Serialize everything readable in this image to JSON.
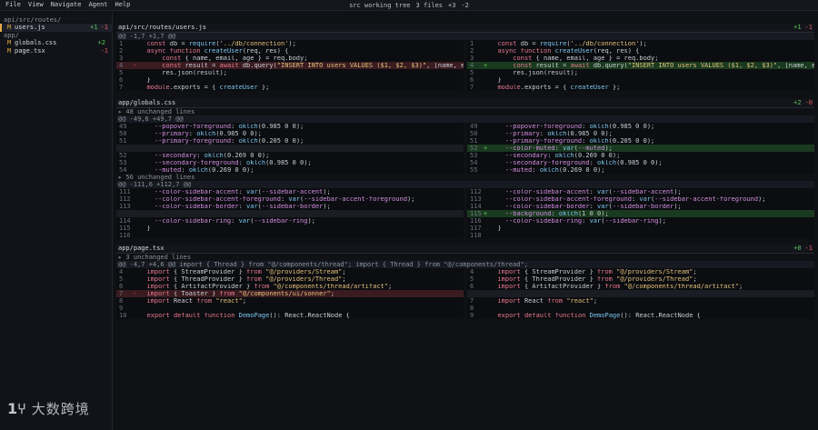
{
  "menubar": {
    "items": [
      "File",
      "View",
      "Navigate",
      "Agent",
      "Help"
    ],
    "status_label": "src working tree",
    "file_count": "3 files",
    "additions": "+3",
    "deletions": "-2"
  },
  "sidebar": {
    "folders": [
      "api/src/routes/",
      "app/"
    ],
    "files": [
      {
        "folder": 0,
        "status": "M",
        "name": "users.js",
        "plus": "+1",
        "minus": "-1",
        "active": true
      },
      {
        "folder": 1,
        "status": "M",
        "name": "globals.css",
        "plus": "+2",
        "minus": "",
        "active": false
      },
      {
        "folder": 1,
        "status": "M",
        "name": "page.tsx",
        "plus": "",
        "minus": "-1",
        "active": false
      }
    ]
  },
  "files": [
    {
      "path": "api/src/routes/users.js",
      "plus": "+1",
      "minus": "-1",
      "sections": [
        {
          "type": "hunk",
          "text": "@@ -1,7 +1,7 @@"
        },
        {
          "type": "rows",
          "rows": [
            {
              "l": {
                "n": "1",
                "k": "",
                "t": "  const db = require('../db/connection');"
              },
              "r": {
                "n": "1",
                "k": "",
                "t": "  const db = require('../db/connection');"
              }
            },
            {
              "l": {
                "n": "2",
                "k": "",
                "t": "  async function createUser(req, res) {"
              },
              "r": {
                "n": "2",
                "k": "",
                "t": "  async function createUser(req, res) {"
              }
            },
            {
              "l": {
                "n": "3",
                "k": "",
                "t": "      const { name, email, age } = req.body;"
              },
              "r": {
                "n": "3",
                "k": "",
                "t": "      const { name, email, age } = req.body;"
              }
            },
            {
              "l": {
                "n": "4",
                "k": "del",
                "t": "      const result = await db.query(\"INSERT INTO users VALUES ($1, $2, $3)\", [name, email, age, address"
              },
              "r": {
                "n": "4",
                "k": "add",
                "t": "      const result = await db.query(\"INSERT INTO users VALUES ($1, $2, $3)\", [name, email, age]);"
              }
            },
            {
              "l": {
                "n": "5",
                "k": "",
                "t": "      res.json(result);"
              },
              "r": {
                "n": "5",
                "k": "",
                "t": "      res.json(result);"
              }
            },
            {
              "l": {
                "n": "6",
                "k": "",
                "t": "  }"
              },
              "r": {
                "n": "6",
                "k": "",
                "t": "  }"
              }
            },
            {
              "l": {
                "n": "7",
                "k": "",
                "t": "  module.exports = { createUser };"
              },
              "r": {
                "n": "7",
                "k": "",
                "t": "  module.exports = { createUser };"
              }
            }
          ]
        }
      ]
    },
    {
      "path": "app/globals.css",
      "plus": "+2",
      "minus": "-0",
      "sections": [
        {
          "type": "collapsed",
          "text": "▸ 48 unchanged lines"
        },
        {
          "type": "hunk",
          "text": "@@ -49,6 +49,7 @@"
        },
        {
          "type": "rows",
          "rows": [
            {
              "l": {
                "n": "49",
                "k": "",
                "t": "    --popover-foreground: oklch(0.985 0 0);"
              },
              "r": {
                "n": "49",
                "k": "",
                "t": "    --popover-foreground: oklch(0.985 0 0);"
              }
            },
            {
              "l": {
                "n": "50",
                "k": "",
                "t": "    --primary: oklch(0.985 0 0);"
              },
              "r": {
                "n": "50",
                "k": "",
                "t": "    --primary: oklch(0.985 0 0);"
              }
            },
            {
              "l": {
                "n": "51",
                "k": "",
                "t": "    --primary-foreground: oklch(0.205 0 0);"
              },
              "r": {
                "n": "51",
                "k": "",
                "t": "    --primary-foreground: oklch(0.205 0 0);"
              }
            },
            {
              "l": {
                "n": "",
                "k": "empty",
                "t": ""
              },
              "r": {
                "n": "52",
                "k": "add",
                "t": "    --color-muted: var(--muted);"
              }
            },
            {
              "l": {
                "n": "52",
                "k": "",
                "t": "    --secondary: oklch(0.269 0 0);"
              },
              "r": {
                "n": "53",
                "k": "",
                "t": "    --secondary: oklch(0.269 0 0);"
              }
            },
            {
              "l": {
                "n": "53",
                "k": "",
                "t": "    --secondary-foreground: oklch(0.985 0 0);"
              },
              "r": {
                "n": "54",
                "k": "",
                "t": "    --secondary-foreground: oklch(0.985 0 0);"
              }
            },
            {
              "l": {
                "n": "54",
                "k": "",
                "t": "    --muted: oklch(0.269 0 0);"
              },
              "r": {
                "n": "55",
                "k": "",
                "t": "    --muted: oklch(0.269 0 0);"
              }
            }
          ]
        },
        {
          "type": "collapsed",
          "text": "▸ 56 unchanged lines"
        },
        {
          "type": "hunk",
          "text": "@@ -111,6 +112,7 @@"
        },
        {
          "type": "rows",
          "rows": [
            {
              "l": {
                "n": "111",
                "k": "",
                "t": "    --color-sidebar-accent: var(--sidebar-accent);"
              },
              "r": {
                "n": "112",
                "k": "",
                "t": "    --color-sidebar-accent: var(--sidebar-accent);"
              }
            },
            {
              "l": {
                "n": "112",
                "k": "",
                "t": "    --color-sidebar-accent-foreground: var(--sidebar-accent-foreground);"
              },
              "r": {
                "n": "113",
                "k": "",
                "t": "    --color-sidebar-accent-foreground: var(--sidebar-accent-foreground);"
              }
            },
            {
              "l": {
                "n": "113",
                "k": "",
                "t": "    --color-sidebar-border: var(--sidebar-border);"
              },
              "r": {
                "n": "114",
                "k": "",
                "t": "    --color-sidebar-border: var(--sidebar-border);"
              }
            },
            {
              "l": {
                "n": "",
                "k": "empty",
                "t": ""
              },
              "r": {
                "n": "115",
                "k": "add",
                "t": "    --background: oklch(1 0 0);"
              }
            },
            {
              "l": {
                "n": "114",
                "k": "",
                "t": "    --color-sidebar-ring: var(--sidebar-ring);"
              },
              "r": {
                "n": "116",
                "k": "",
                "t": "    --color-sidebar-ring: var(--sidebar-ring);"
              }
            },
            {
              "l": {
                "n": "115",
                "k": "",
                "t": "  }"
              },
              "r": {
                "n": "117",
                "k": "",
                "t": "  }"
              }
            },
            {
              "l": {
                "n": "116",
                "k": "",
                "t": ""
              },
              "r": {
                "n": "118",
                "k": "",
                "t": ""
              }
            }
          ]
        }
      ]
    },
    {
      "path": "app/page.tsx",
      "plus": "+0",
      "minus": "-1",
      "sections": [
        {
          "type": "collapsed",
          "text": "▸ 3 unchanged lines"
        },
        {
          "type": "hunk",
          "text": "@@ -4,7 +4,6 @@ import { Thread } from \"@/components/thread\"; import { Thread } from \"@/components/thread\";"
        },
        {
          "type": "rows",
          "rows": [
            {
              "l": {
                "n": "4",
                "k": "",
                "t": "  import { StreamProvider } from \"@/providers/Stream\";"
              },
              "r": {
                "n": "4",
                "k": "",
                "t": "  import { StreamProvider } from \"@/providers/Stream\";"
              }
            },
            {
              "l": {
                "n": "5",
                "k": "",
                "t": "  import { ThreadProvider } from \"@/providers/Thread\";"
              },
              "r": {
                "n": "5",
                "k": "",
                "t": "  import { ThreadProvider } from \"@/providers/Thread\";"
              }
            },
            {
              "l": {
                "n": "6",
                "k": "",
                "t": "  import { ArtifactProvider } from \"@/components/thread/artifact\";"
              },
              "r": {
                "n": "6",
                "k": "",
                "t": "  import { ArtifactProvider } from \"@/components/thread/artifact\";"
              }
            },
            {
              "l": {
                "n": "7",
                "k": "del",
                "t": "  import { Toaster } from \"@/components/ui/sonner\";"
              },
              "r": {
                "n": "",
                "k": "empty",
                "t": ""
              }
            },
            {
              "l": {
                "n": "8",
                "k": "",
                "t": "  import React from \"react\";"
              },
              "r": {
                "n": "7",
                "k": "",
                "t": "  import React from \"react\";"
              }
            },
            {
              "l": {
                "n": "9",
                "k": "",
                "t": ""
              },
              "r": {
                "n": "8",
                "k": "",
                "t": ""
              }
            },
            {
              "l": {
                "n": "10",
                "k": "",
                "t": "  export default function DemoPage(): React.ReactNode {"
              },
              "r": {
                "n": "9",
                "k": "",
                "t": "  export default function DemoPage(): React.ReactNode {"
              }
            }
          ]
        }
      ]
    }
  ],
  "watermark": {
    "logo": "1⑂",
    "text": "大数跨境"
  }
}
